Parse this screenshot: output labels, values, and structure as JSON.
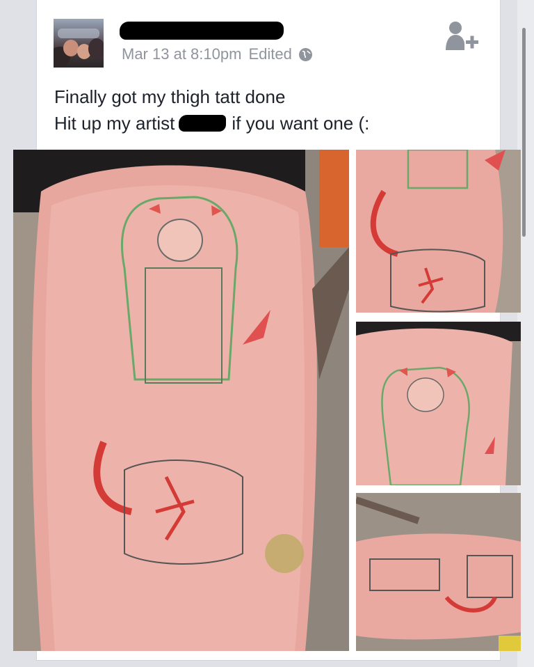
{
  "post": {
    "timestamp": "Mar 13 at 8:10pm",
    "edited": "Edited",
    "text_line1": "Finally got my thigh tatt done",
    "text_line2_start": "Hit up my artist",
    "text_line2_end": "if you want one (:"
  },
  "icons": {
    "privacy": "globe-icon",
    "add_friend": "add-friend-icon"
  },
  "colors": {
    "meta_text": "#90949c",
    "body_text": "#1d2129",
    "icon_gray": "#90949c"
  }
}
